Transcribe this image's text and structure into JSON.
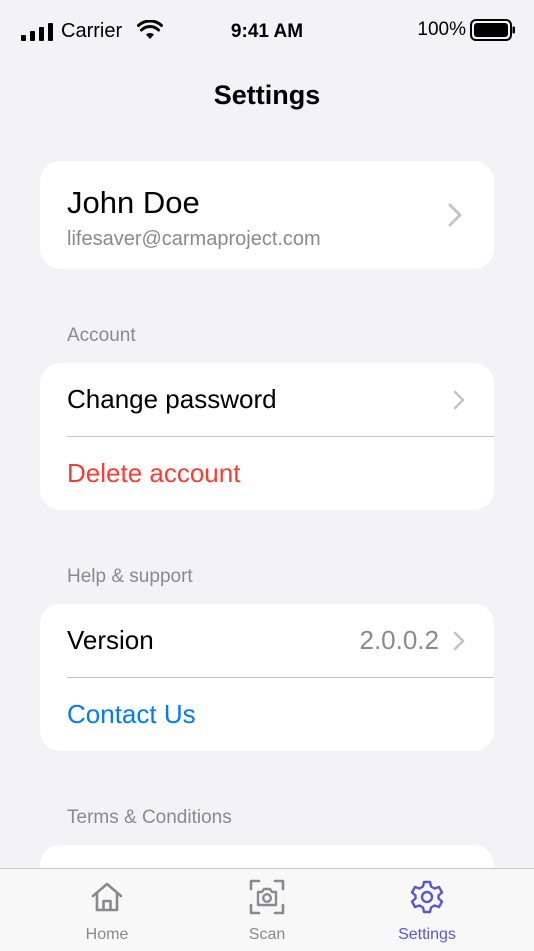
{
  "status_bar": {
    "carrier": "Carrier",
    "time": "9:41 AM",
    "battery": "100%"
  },
  "header": {
    "title": "Settings"
  },
  "profile": {
    "name": "John Doe",
    "email": "lifesaver@carmaproject.com"
  },
  "sections": {
    "account": {
      "title": "Account",
      "change_password": "Change password",
      "delete_account": "Delete account"
    },
    "help": {
      "title": "Help & support",
      "version_label": "Version",
      "version_value": "2.0.0.2",
      "contact": "Contact Us"
    },
    "terms": {
      "title": "Terms & Conditions"
    }
  },
  "tab_bar": {
    "tabs": [
      {
        "label": "Home",
        "icon": "home-icon"
      },
      {
        "label": "Scan",
        "icon": "scan-icon"
      },
      {
        "label": "Settings",
        "icon": "gear-icon",
        "active": true
      }
    ]
  },
  "colors": {
    "background": "#F2F2F7",
    "danger": "#FF3B30",
    "link": "#007AFF",
    "active_tab": "#5856D6",
    "secondary_text": "#8A8A8E"
  }
}
